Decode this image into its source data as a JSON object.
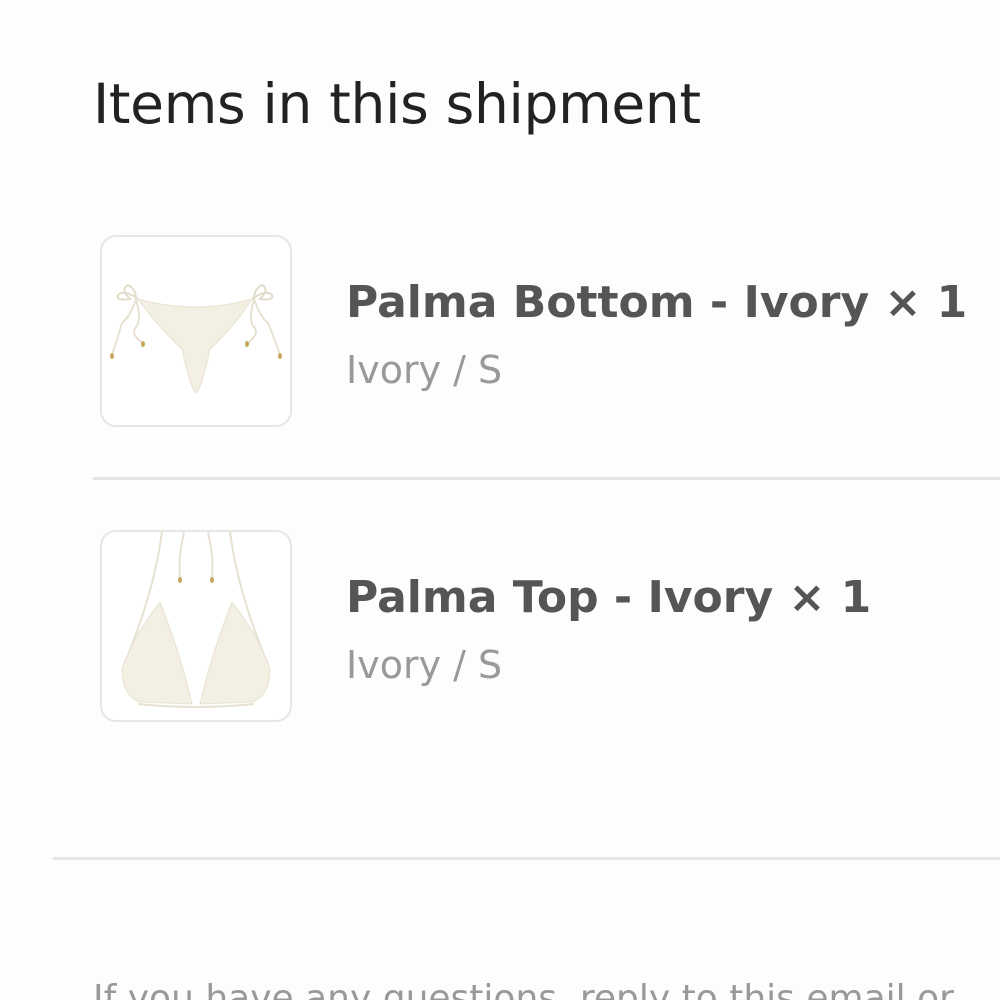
{
  "shipment": {
    "title": "Items in this shipment",
    "items": [
      {
        "name": "Palma Bottom - Ivory × 1",
        "variant": "Ivory / S",
        "image_icon": "bikini-bottom-image"
      },
      {
        "name": "Palma Top - Ivory × 1",
        "variant": "Ivory / S",
        "image_icon": "bikini-top-image"
      }
    ]
  },
  "footer": {
    "text": "If you have any questions, reply to this email or"
  },
  "colors": {
    "title": "#222222",
    "item_name": "#555555",
    "muted": "#999999",
    "divider": "#e5e5e5",
    "product_ivory": "#f3efe3"
  }
}
